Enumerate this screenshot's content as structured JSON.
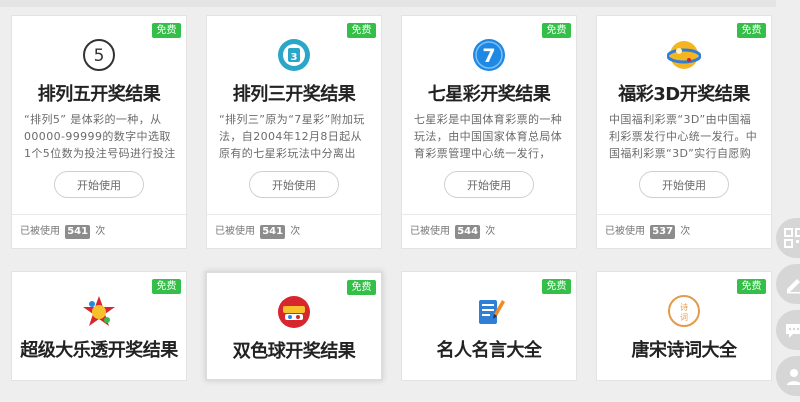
{
  "cards_row1": [
    {
      "title": "排列五开奖结果",
      "badge": "免费",
      "icon": "number-5-icon",
      "description": "“排列5” 是体彩的一种，从00000-99999的数字中选取1个5位数为投注号码进行投注",
      "button": "开始使用",
      "usage_prefix": "已被使用",
      "usage_count": "541",
      "usage_suffix": "次"
    },
    {
      "title": "排列三开奖结果",
      "badge": "免费",
      "icon": "lottery-3-icon",
      "description": "“排列三”原为“7星彩”附加玩法，自2004年12月8日起从原有的七星彩玩法中分离出",
      "button": "开始使用",
      "usage_prefix": "已被使用",
      "usage_count": "541",
      "usage_suffix": "次"
    },
    {
      "title": "七星彩开奖结果",
      "badge": "免费",
      "icon": "number-7-icon",
      "description": "七星彩是中国体育彩票的一种玩法，由中国国家体育总局体育彩票管理中心统一发行，",
      "button": "开始使用",
      "usage_prefix": "已被使用",
      "usage_count": "544",
      "usage_suffix": "次"
    },
    {
      "title": "福彩3D开奖结果",
      "badge": "免费",
      "icon": "fucai-3d-icon",
      "description": "中国福利彩票“3D”由中国福利彩票发行中心统一发行。中国福利彩票“3D”实行自愿购",
      "button": "开始使用",
      "usage_prefix": "已被使用",
      "usage_count": "537",
      "usage_suffix": "次"
    }
  ],
  "cards_row2": [
    {
      "title": "超级大乐透开奖结果",
      "badge": "免费",
      "icon": "super-lotto-icon"
    },
    {
      "title": "双色球开奖结果",
      "badge": "免费",
      "icon": "double-color-ball-icon"
    },
    {
      "title": "名人名言大全",
      "badge": "免费",
      "icon": "notepad-pen-icon"
    },
    {
      "title": "唐宋诗词大全",
      "badge": "免费",
      "icon": "poem-icon",
      "icon_text": "诗词"
    }
  ],
  "colors": {
    "badge": "#34bf49",
    "accent_blue": "#1e88e5",
    "accent_red": "#d7262e"
  }
}
